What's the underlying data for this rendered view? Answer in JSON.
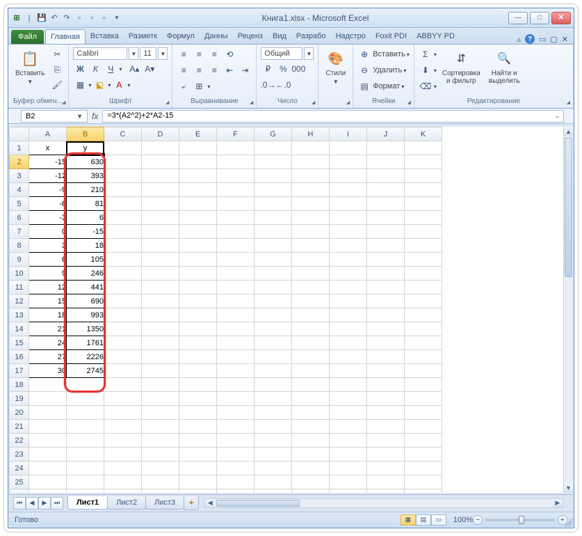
{
  "window": {
    "title": "Книга1.xlsx - Microsoft Excel"
  },
  "ribbon": {
    "file": "Файл",
    "tabs": [
      "Главная",
      "Вставка",
      "Разметк",
      "Формул",
      "Данны",
      "Реценз",
      "Вид",
      "Разрабо",
      "Надстро",
      "Foxit PDI",
      "ABBYY PD"
    ],
    "active_tab": 0,
    "groups": {
      "clipboard": {
        "label": "Буфер обмен…",
        "paste": "Вставить"
      },
      "font": {
        "label": "Шрифт",
        "name": "Calibri",
        "size": "11"
      },
      "align": {
        "label": "Выравнивание"
      },
      "number": {
        "label": "Число",
        "format": "Общий"
      },
      "styles": {
        "label": "",
        "styles_btn": "Стили"
      },
      "cells": {
        "label": "Ячейки",
        "insert": "Вставить",
        "delete": "Удалить",
        "format": "Формат"
      },
      "editing": {
        "label": "Редактирование",
        "sort": "Сортировка\nи фильтр",
        "find": "Найти и\nвыделить"
      }
    }
  },
  "formula_bar": {
    "name_box": "B2",
    "formula": "=3*(A2^2)+2*A2-15"
  },
  "columns": [
    "A",
    "B",
    "C",
    "D",
    "E",
    "F",
    "G",
    "H",
    "I",
    "J",
    "K"
  ],
  "headers": {
    "A": "x",
    "B": "y"
  },
  "rows": [
    {
      "n": 1,
      "A": "x",
      "B": "y"
    },
    {
      "n": 2,
      "A": "-15",
      "B": "630"
    },
    {
      "n": 3,
      "A": "-12",
      "B": "393"
    },
    {
      "n": 4,
      "A": "-9",
      "B": "210"
    },
    {
      "n": 5,
      "A": "-6",
      "B": "81"
    },
    {
      "n": 6,
      "A": "-3",
      "B": "6"
    },
    {
      "n": 7,
      "A": "0",
      "B": "-15"
    },
    {
      "n": 8,
      "A": "3",
      "B": "18"
    },
    {
      "n": 9,
      "A": "6",
      "B": "105"
    },
    {
      "n": 10,
      "A": "9",
      "B": "246"
    },
    {
      "n": 11,
      "A": "12",
      "B": "441"
    },
    {
      "n": 12,
      "A": "15",
      "B": "690"
    },
    {
      "n": 13,
      "A": "18",
      "B": "993"
    },
    {
      "n": 14,
      "A": "21",
      "B": "1350"
    },
    {
      "n": 15,
      "A": "24",
      "B": "1761"
    },
    {
      "n": 16,
      "A": "27",
      "B": "2226"
    },
    {
      "n": 17,
      "A": "30",
      "B": "2745"
    }
  ],
  "empty_rows": [
    18,
    19,
    20,
    21,
    22,
    23,
    24,
    25,
    26
  ],
  "active_cell": "B2",
  "sheet_tabs": {
    "tabs": [
      "Лист1",
      "Лист2",
      "Лист3"
    ],
    "active": 0
  },
  "status": {
    "ready": "Готово",
    "zoom": "100%"
  }
}
